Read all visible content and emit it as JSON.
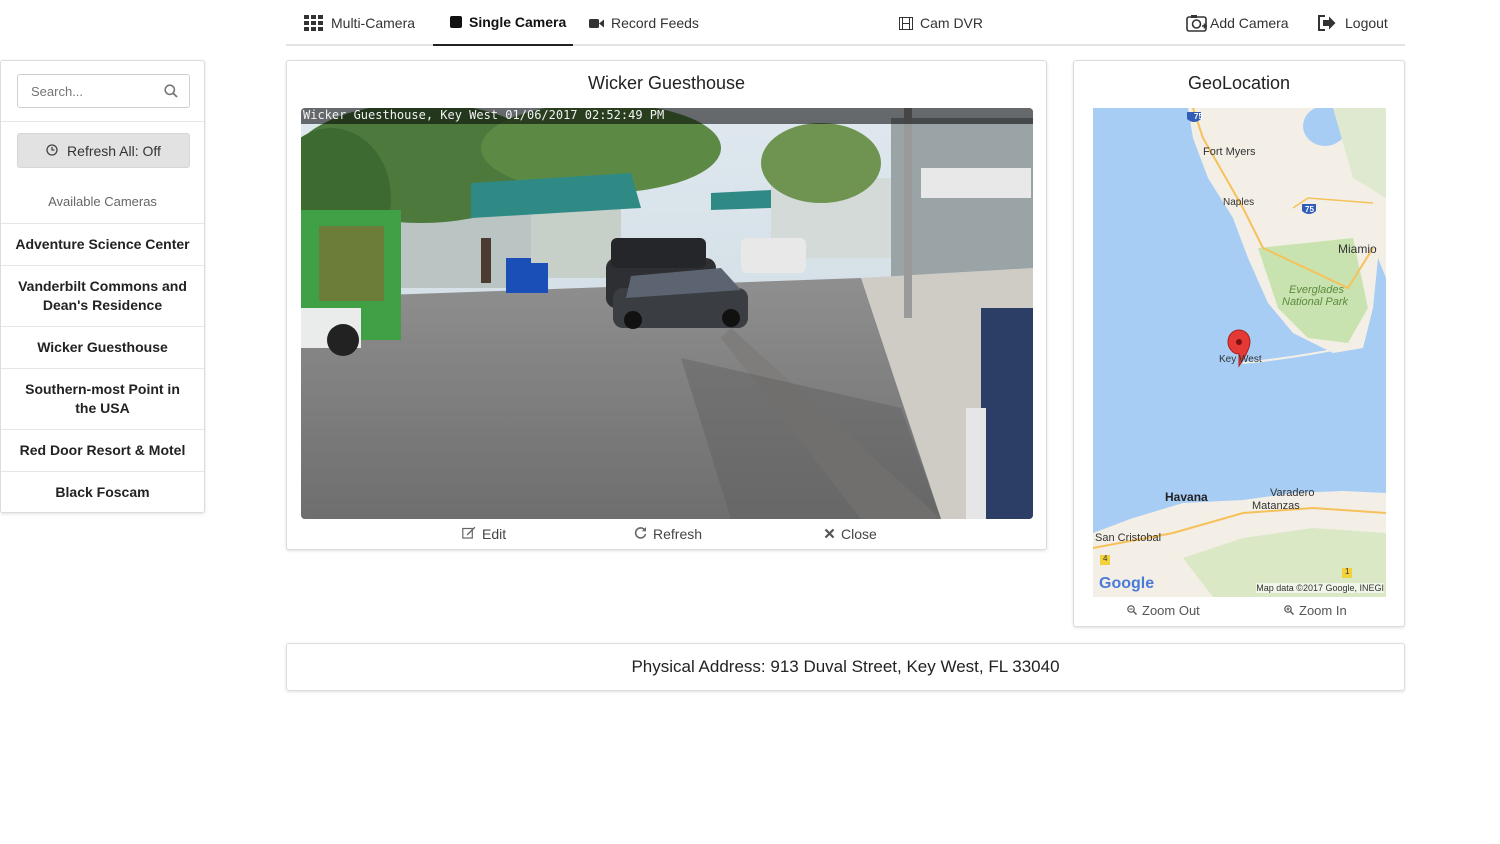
{
  "nav": {
    "multi_camera": "Multi-Camera",
    "single_camera": "Single Camera",
    "record_feeds": "Record Feeds",
    "cam_dvr": "Cam DVR",
    "add_camera": "Add Camera",
    "logout": "Logout",
    "active_tab": "single_camera"
  },
  "sidebar": {
    "search_placeholder": "Search...",
    "refresh_all_label": "Refresh All: Off",
    "available_label": "Available Cameras",
    "cameras": [
      "Adventure Science Center",
      "Vanderbilt Commons and Dean's Residence",
      "Wicker Guesthouse",
      "Southern-most Point in the USA",
      "Red Door Resort & Motel",
      "Black Foscam"
    ]
  },
  "camera": {
    "title": "Wicker Guesthouse",
    "overlay": "Wicker Guesthouse, Key West 01/06/2017 02:52:49 PM",
    "edit_label": "Edit",
    "refresh_label": "Refresh",
    "close_label": "Close"
  },
  "geo": {
    "title": "GeoLocation",
    "zoom_out_label": "Zoom Out",
    "zoom_in_label": "Zoom In",
    "map_labels": {
      "fort_myers": "Fort Myers",
      "naples": "Naples",
      "miami": "Miamio",
      "everglades_1": "Everglades",
      "everglades_2": "National Park",
      "key_west": "Key West",
      "havana": "Havana",
      "varadero": "Varadero",
      "matanzas": "Matanzas",
      "san_cristobal": "San Cristobal",
      "google": "Google",
      "map_data": "Map data ©2017 Google, INEGI",
      "i75_top": "75",
      "i75_mid": "75",
      "shield_4": "4",
      "shield_1": "1"
    }
  },
  "address": {
    "text": "Physical Address: 913 Duval Street, Key West, FL 33040"
  },
  "colors": {
    "accent": "#222222",
    "water": "#a8cdf4",
    "land": "#f3efe6",
    "park": "#c9e3b0",
    "marker": "#e53935"
  }
}
